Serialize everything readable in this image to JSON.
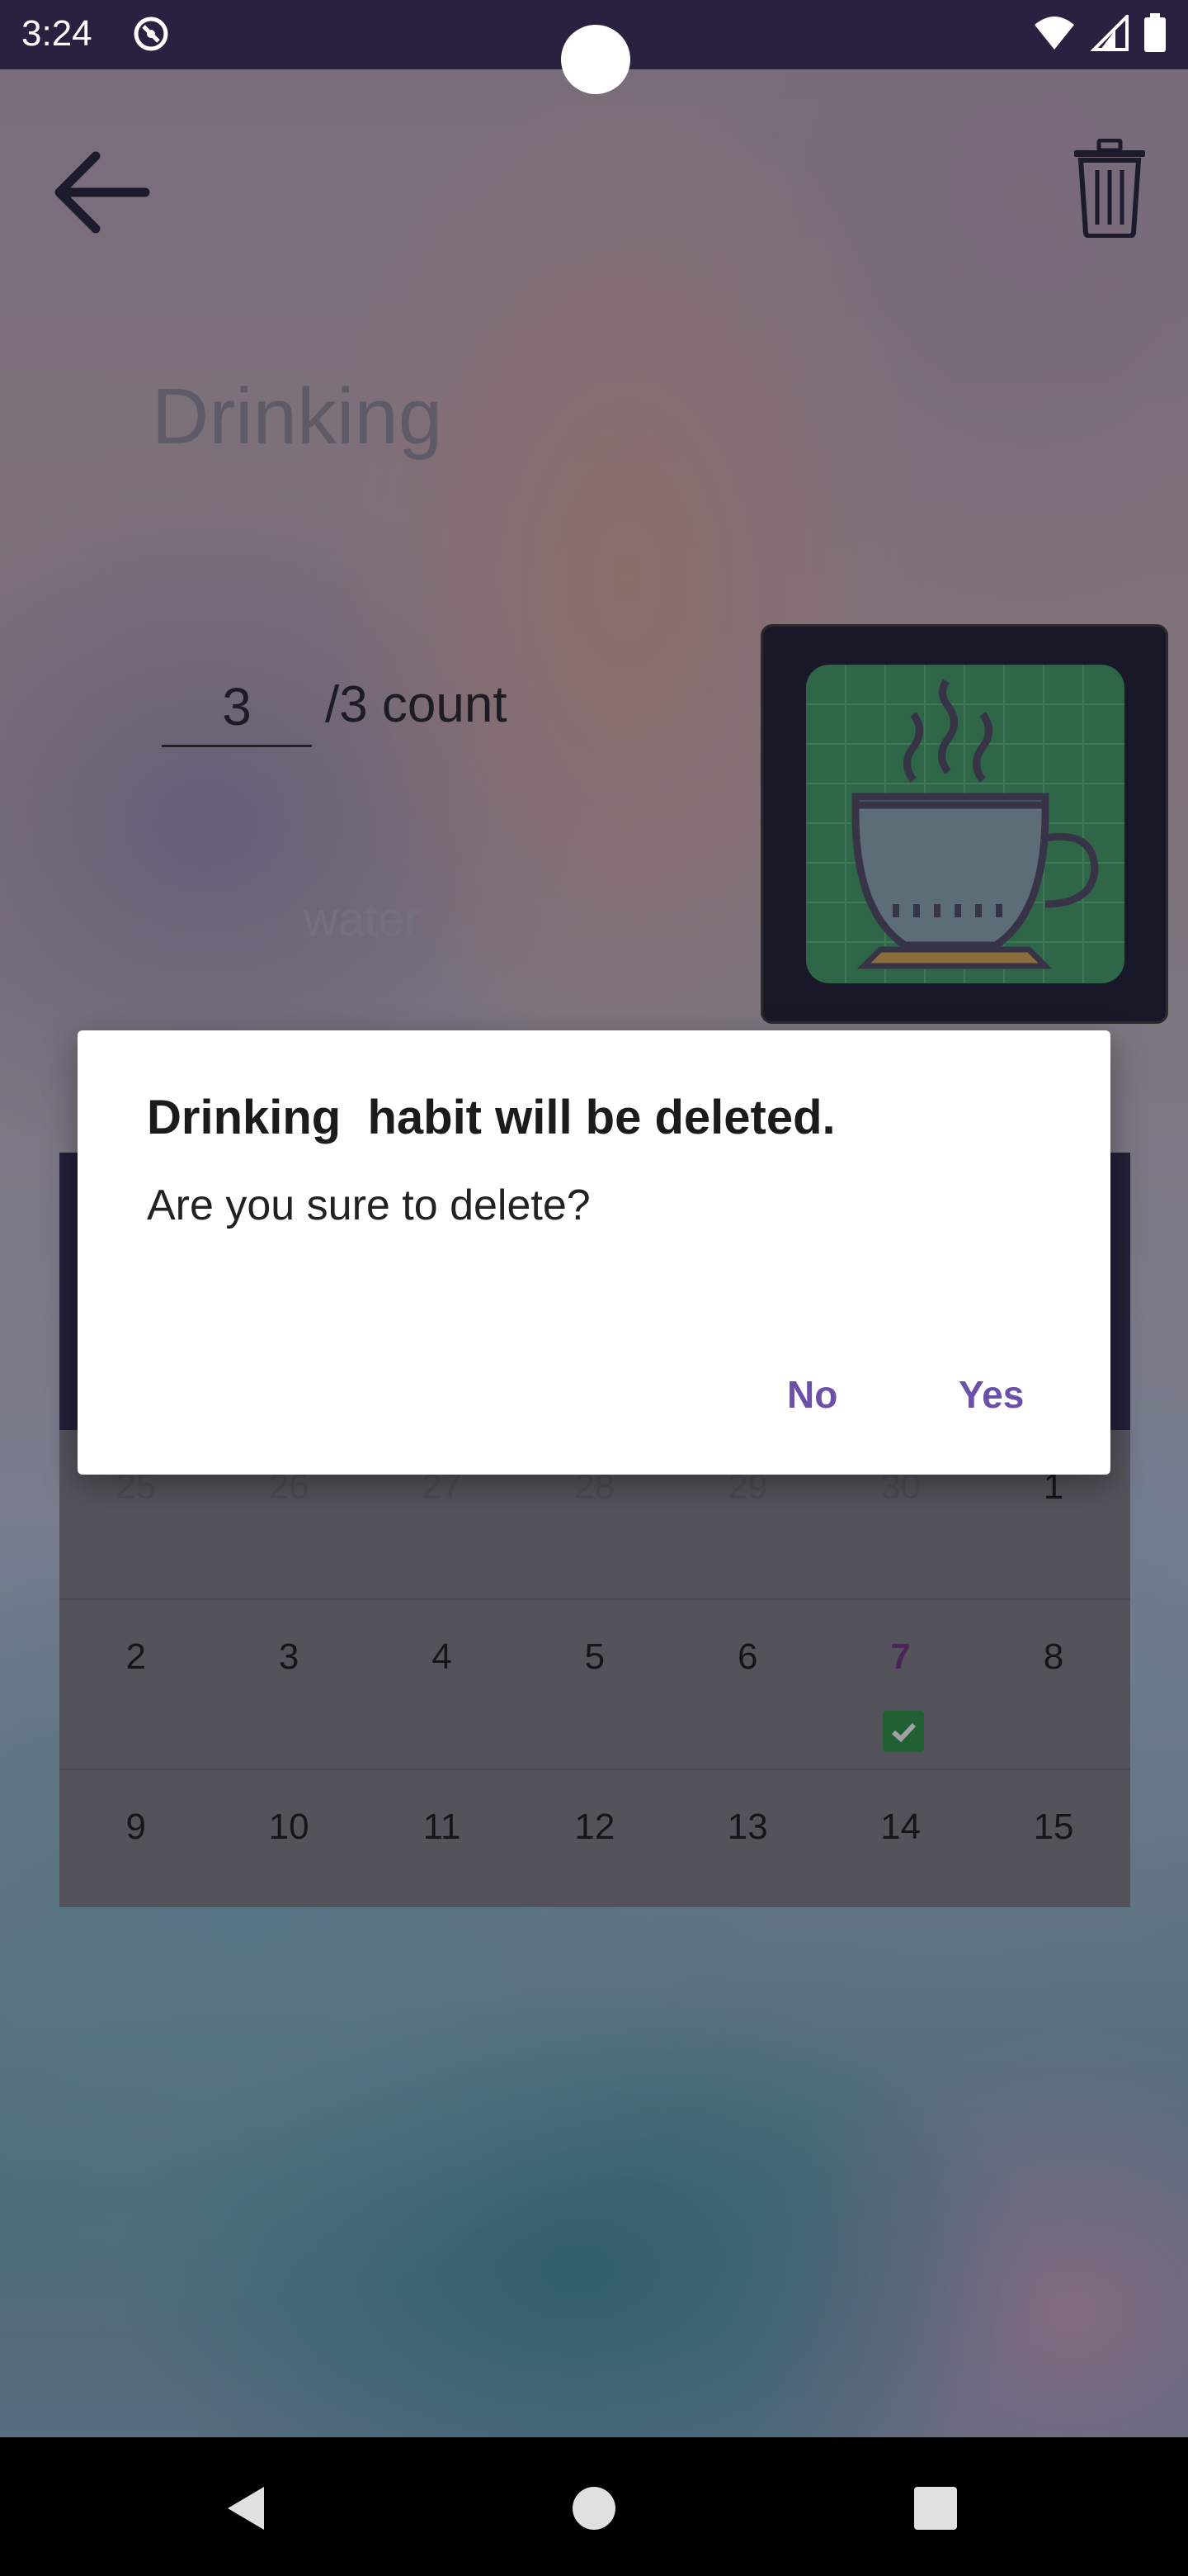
{
  "status_bar": {
    "time": "3:24",
    "icons": [
      "app-notification-icon",
      "wifi-icon",
      "signal-icon",
      "battery-icon"
    ]
  },
  "header": {
    "back_icon": "arrow-left-icon",
    "delete_icon": "trash-icon"
  },
  "habit": {
    "title": "Drinking",
    "count_value": "3",
    "count_suffix": "/3 count",
    "description": "water",
    "icon": "coffee-cup-icon",
    "icon_tile_color": "#3a9c5e"
  },
  "calendar": {
    "rows": [
      [
        "25",
        "26",
        "27",
        "28",
        "29",
        "30",
        "1"
      ],
      [
        "2",
        "3",
        "4",
        "5",
        "6",
        "7",
        "8"
      ],
      [
        "9",
        "10",
        "11",
        "12",
        "13",
        "14",
        "15"
      ]
    ],
    "today": "7",
    "completed_day": "7"
  },
  "dialog": {
    "title": "Drinking  habit will be deleted.",
    "message": "Are you sure to delete?",
    "no_label": "No",
    "yes_label": "Yes",
    "accent_color": "#6b4fa8"
  },
  "nav_bar": {
    "icons": [
      "nav-back-icon",
      "nav-home-icon",
      "nav-recents-icon"
    ]
  }
}
